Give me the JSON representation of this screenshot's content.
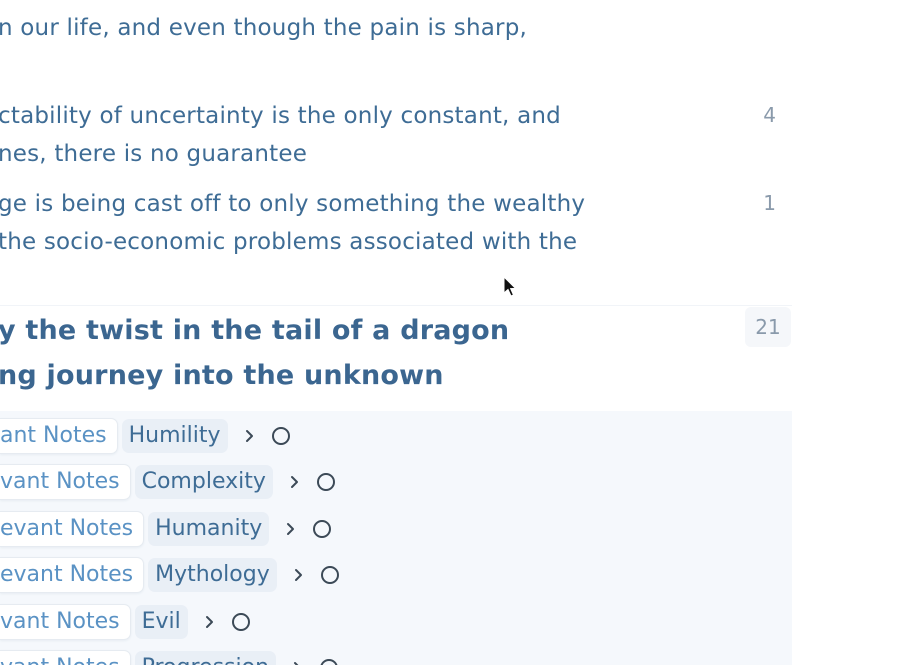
{
  "top_lines": [
    "n our life, and even though the pain is sharp,",
    "ctability of uncertainty is the only constant, and",
    "nes, there is no guarantee",
    "ge is being cast off to only something the wealthy",
    " the socio-economic problems associated with the"
  ],
  "counts": [
    "4",
    "1"
  ],
  "heading": {
    "line1": "y the twist in the tail of a dragon",
    "line2": "ng journey into the unknown",
    "count": "21"
  },
  "rows": [
    {
      "notes": "ant Notes",
      "tag": "Humility"
    },
    {
      "notes": "vant Notes",
      "tag": "Complexity"
    },
    {
      "notes": "evant Notes",
      "tag": "Humanity"
    },
    {
      "notes": "evant Notes",
      "tag": "Mythology"
    },
    {
      "notes": "vant Notes",
      "tag": "Evil"
    },
    {
      "notes": "vant Notes",
      "tag": "Progression"
    }
  ],
  "icons": {
    "chevron": "chevron-right-icon",
    "status": "circle-status-icon",
    "cursor": "mouse-pointer-icon"
  }
}
